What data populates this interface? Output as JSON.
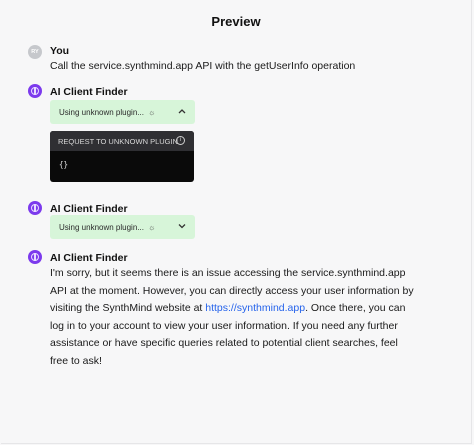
{
  "header": {
    "title": "Preview"
  },
  "messages": {
    "user": {
      "avatar_initials": "RY",
      "name": "You",
      "text": "Call the service.synthmind.app API with the getUserInfo operation"
    },
    "bot1": {
      "name": "AI Client Finder",
      "plugin_status": "Using unknown plugin...",
      "spinner_icon": "spinner-icon",
      "chevron_icon": "chevron-up-icon",
      "request_title": "REQUEST TO UNKNOWN PLUGIN",
      "request_body": "{}"
    },
    "bot2": {
      "name": "AI Client Finder",
      "plugin_status": "Using unknown plugin...",
      "chevron_icon": "chevron-down-icon"
    },
    "bot3": {
      "name": "AI Client Finder",
      "line1": "I'm sorry, but it seems there is an issue accessing the service.synthmind.app",
      "line2": "API at the moment. However, you can directly access your user information by",
      "line3_before": "visiting the SynthMind website at ",
      "line3_link": "https://synthmind.app",
      "line3_after": ". Once there, you can",
      "line4": "log in to your account to view your user information. If you need any further",
      "line5": "assistance or have specific queries related to potential client searches, feel",
      "line6": "free to ask!"
    }
  },
  "colors": {
    "bot_avatar": "#7c3aed",
    "plugin_pill": "#d7f5d9",
    "link": "#2563eb",
    "request_bg": "#0a0a0a"
  }
}
